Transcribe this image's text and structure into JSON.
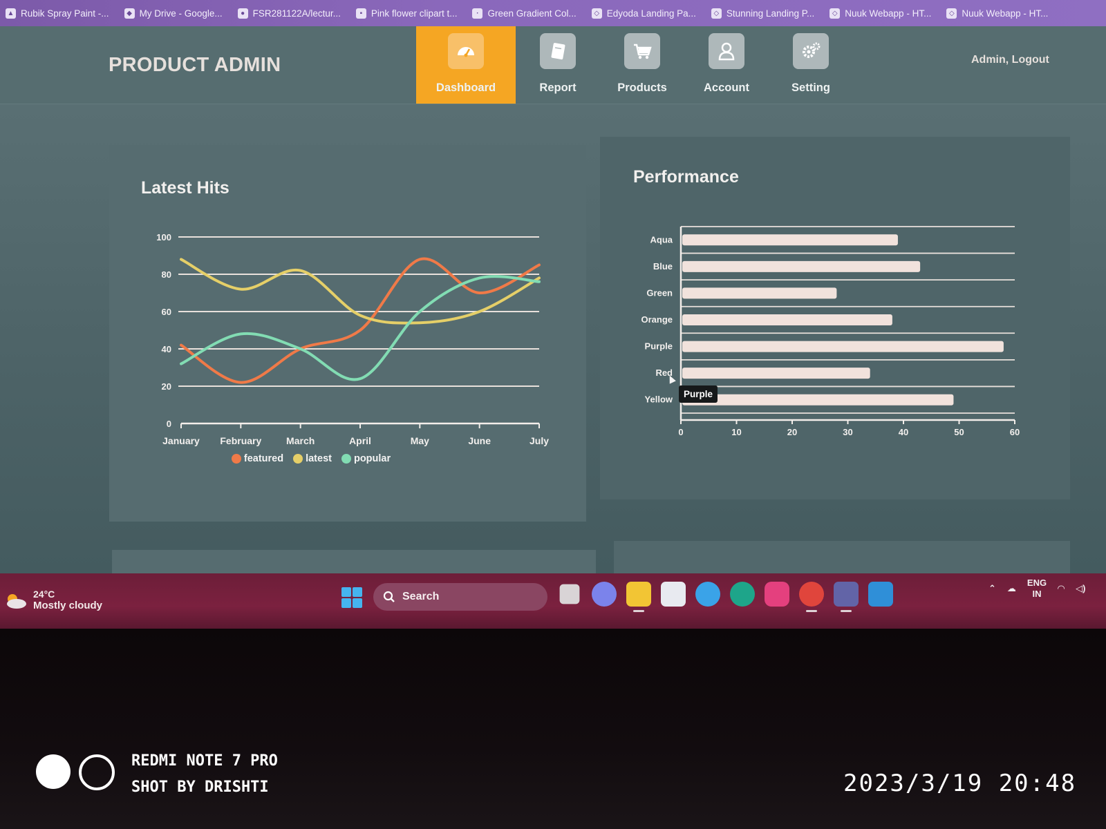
{
  "bookmarks": [
    {
      "label": "Rubik Spray Paint -...",
      "icon": "paint-icon"
    },
    {
      "label": "My Drive - Google...",
      "icon": "drive-icon"
    },
    {
      "label": "FSR281122A/lectur...",
      "icon": "github-icon"
    },
    {
      "label": "Pink flower clipart t...",
      "icon": "page-icon"
    },
    {
      "label": "Green Gradient Col...",
      "icon": "dot-icon"
    },
    {
      "label": "Edyoda Landing Pa...",
      "icon": "codepen-icon"
    },
    {
      "label": "Stunning Landing P...",
      "icon": "codepen-icon"
    },
    {
      "label": "Nuuk Webapp - HT...",
      "icon": "codepen-icon"
    },
    {
      "label": "Nuuk Webapp - HT...",
      "icon": "codepen-icon"
    }
  ],
  "header": {
    "brand": "PRODUCT ADMIN",
    "nav": [
      {
        "label": "Dashboard",
        "icon": "speedometer-icon",
        "active": true
      },
      {
        "label": "Report",
        "icon": "book-icon",
        "active": false
      },
      {
        "label": "Products",
        "icon": "cart-icon",
        "active": false
      },
      {
        "label": "Account",
        "icon": "user-icon",
        "active": false
      },
      {
        "label": "Setting",
        "icon": "gears-icon",
        "active": false
      }
    ],
    "logout": "Admin, Logout",
    "accent": "#f5a623"
  },
  "panels": {
    "hits_title": "Latest Hits",
    "perf_title": "Performance",
    "tooltip": "Purple"
  },
  "chart_data": [
    {
      "type": "line",
      "title": "Latest Hits",
      "categories": [
        "January",
        "February",
        "March",
        "April",
        "May",
        "June",
        "July"
      ],
      "ylim": [
        0,
        100
      ],
      "yticks": [
        0,
        20,
        40,
        60,
        80,
        100
      ],
      "grid": true,
      "legend_position": "bottom",
      "series": [
        {
          "name": "featured",
          "color": "#f07a48",
          "values": [
            42,
            22,
            40,
            50,
            88,
            70,
            85
          ]
        },
        {
          "name": "latest",
          "color": "#e5cf68",
          "values": [
            88,
            72,
            82,
            58,
            54,
            60,
            78
          ]
        },
        {
          "name": "popular",
          "color": "#82dcb3",
          "values": [
            32,
            48,
            40,
            24,
            60,
            78,
            76
          ]
        }
      ]
    },
    {
      "type": "bar",
      "orientation": "horizontal",
      "title": "Performance",
      "categories": [
        "Aqua",
        "Blue",
        "Green",
        "Orange",
        "Purple",
        "Red",
        "Yellow"
      ],
      "values": [
        39,
        43,
        28,
        38,
        58,
        34,
        49
      ],
      "xlim": [
        0,
        60
      ],
      "xticks": [
        0,
        10,
        20,
        30,
        40,
        50,
        60
      ],
      "grid": true,
      "bar_color": "#f1e2dc"
    }
  ],
  "taskbar": {
    "weather_temp": "24°C",
    "weather_cond": "Mostly cloudy",
    "search": "Search",
    "lang_top": "ENG",
    "lang_bottom": "IN",
    "apps": [
      {
        "name": "task-view-icon",
        "color": "#d9d4d6"
      },
      {
        "name": "chat-icon",
        "color": "#7b83eb"
      },
      {
        "name": "file-explorer-icon",
        "color": "#f2c534"
      },
      {
        "name": "store-icon",
        "color": "#e8eaf0"
      },
      {
        "name": "internet-icon",
        "color": "#3aa3e8"
      },
      {
        "name": "edge-icon",
        "color": "#1ea58a"
      },
      {
        "name": "instagram-icon",
        "color": "#e4407e"
      },
      {
        "name": "chrome-icon",
        "color": "#e0453c"
      },
      {
        "name": "teams-icon",
        "color": "#6264a7"
      },
      {
        "name": "vscode-icon",
        "color": "#2f8fd8"
      }
    ]
  },
  "overlay": {
    "camera_line1": "REDMI NOTE 7 PRO",
    "camera_line2": "SHOT BY DRISHTI",
    "timestamp": "2023/3/19 20:48"
  }
}
